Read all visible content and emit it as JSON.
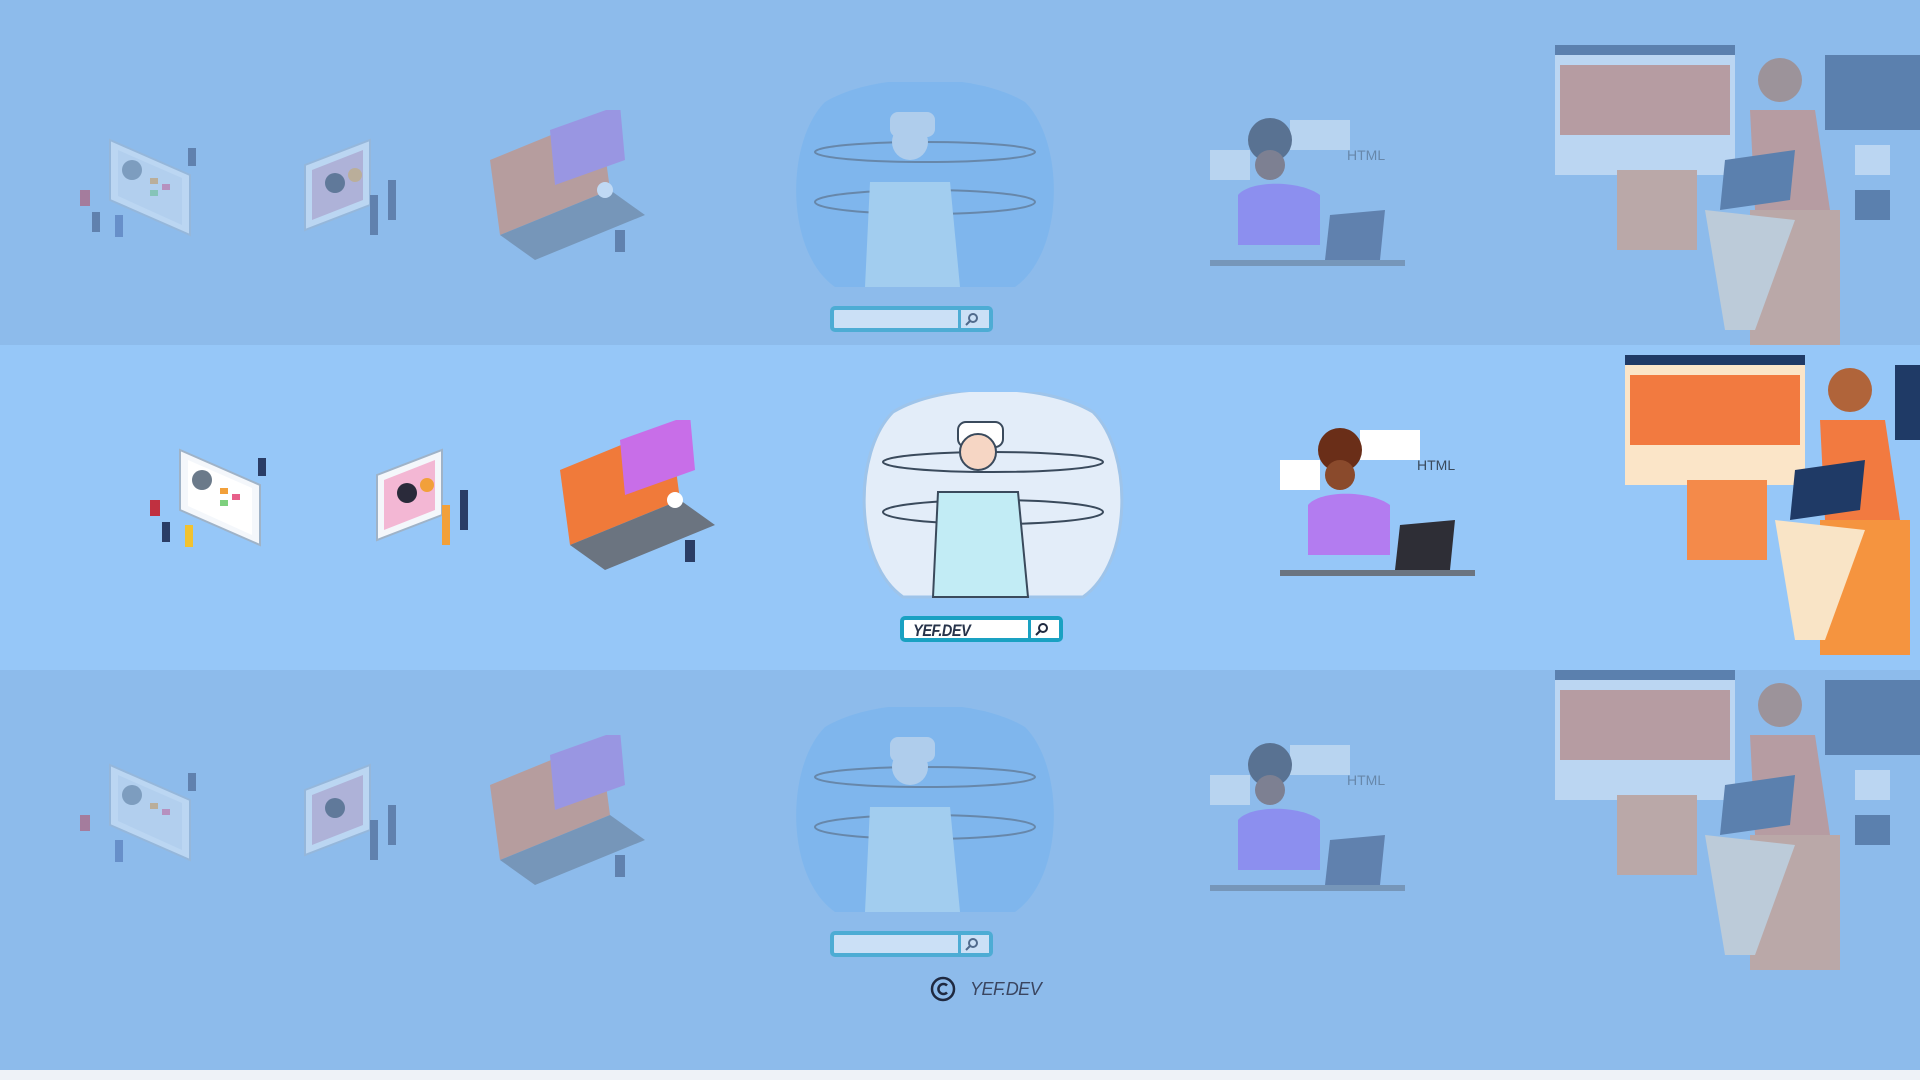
{
  "colors": {
    "background": "#8dbbeb",
    "middle_band": "#96c7f8",
    "search_border": "#1aa1c2",
    "text_dark": "#27334a"
  },
  "search": {
    "value": "YEF.DEV",
    "icon": "magnifier-icon"
  },
  "footer": {
    "copyright_icon": "copyright-icon",
    "brand": "YEF.DEV"
  },
  "illustrations": {
    "html_tag": "HTML"
  }
}
